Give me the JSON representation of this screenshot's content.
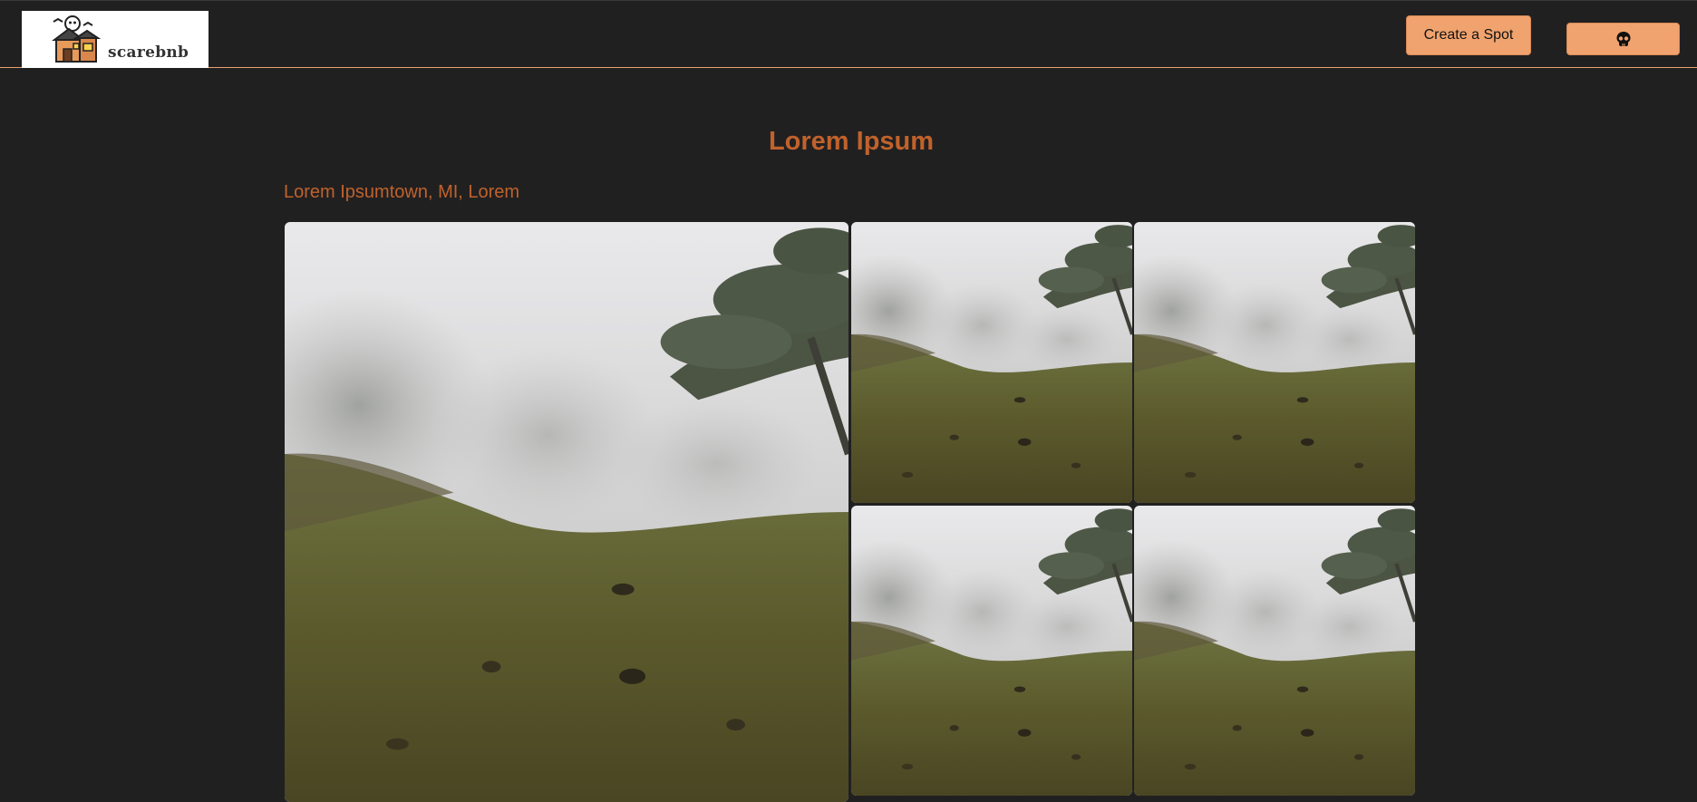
{
  "header": {
    "logo_text": "scarebnb",
    "create_spot_label": "Create a Spot",
    "profile_icon": "skull-icon"
  },
  "spot": {
    "title": "Lorem Ipsum",
    "location": "Lorem Ipsumtown, MI, Lorem"
  },
  "gallery": {
    "images": [
      {
        "subject": "foggy-hillside-main"
      },
      {
        "subject": "foggy-hillside"
      },
      {
        "subject": "foggy-hillside"
      },
      {
        "subject": "foggy-hillside"
      },
      {
        "subject": "foggy-hillside"
      }
    ]
  },
  "colors": {
    "background": "#212021",
    "accent": "#f0a36e",
    "title": "#c0622b"
  }
}
